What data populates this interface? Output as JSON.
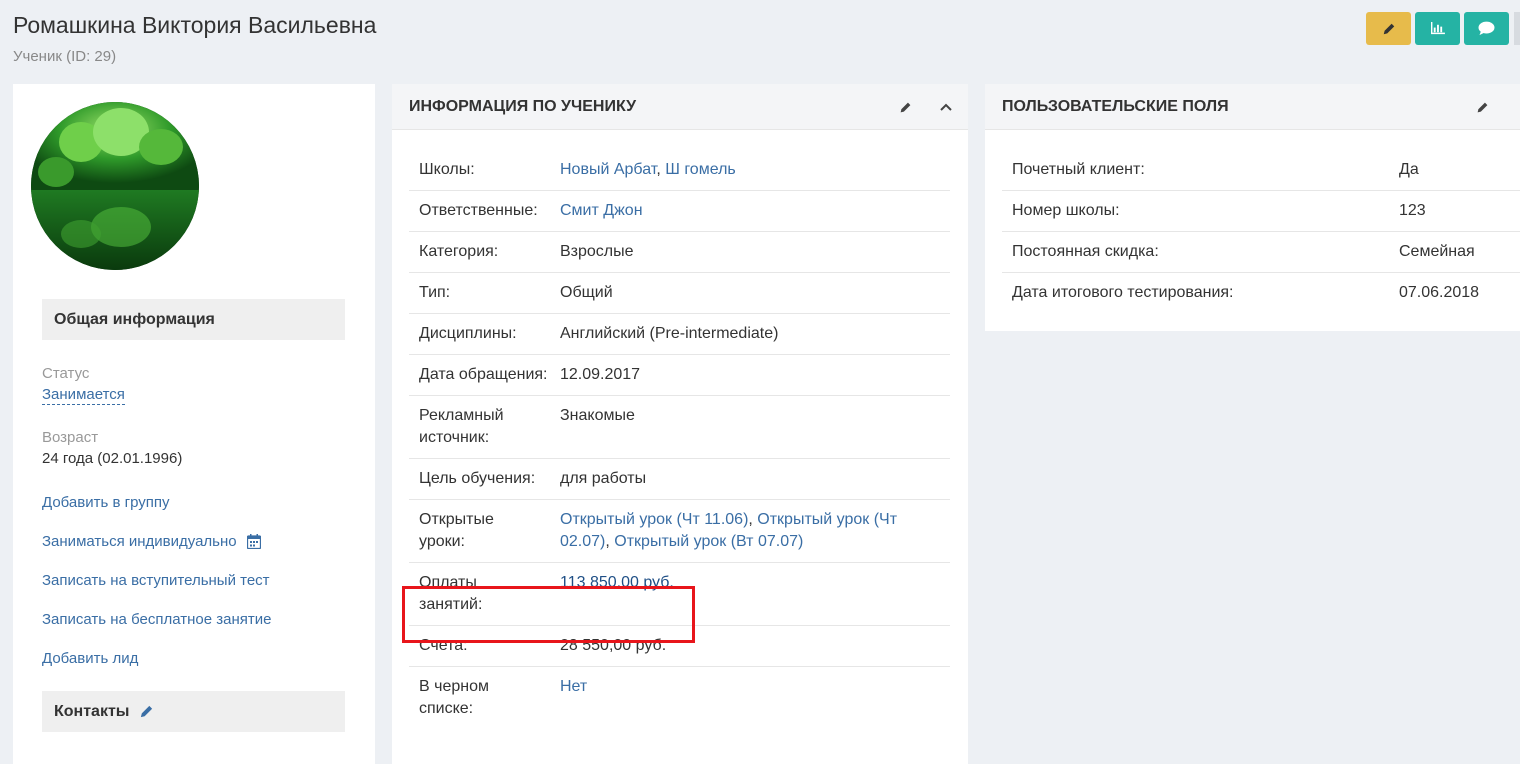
{
  "header": {
    "title": "Ромашкина Виктория Васильевна",
    "subtitle": "Ученик (ID: 29)"
  },
  "colors": {
    "accent": "#25b3a4",
    "edit": "#e7bb4b",
    "link": "#3a6ea5",
    "highlight": "#e8151b"
  },
  "left": {
    "general_title": "Общая информация",
    "status_label": "Статус",
    "status_value": "Занимается",
    "age_label": "Возраст",
    "age_value": "24 года (02.01.1996)",
    "actions": [
      "Добавить в группу",
      "Заниматься индивидуально",
      "Записать на вступительный тест",
      "Записать на бесплатное занятие",
      "Добавить лид"
    ],
    "contacts_title": "Контакты"
  },
  "info": {
    "title": "ИНФОРМАЦИЯ ПО УЧЕНИКУ",
    "rows": [
      {
        "label": "Школы:",
        "links": [
          "Новый Арбат",
          "Ш гомель"
        ]
      },
      {
        "label": "Ответственные:",
        "links": [
          "Смит Джон"
        ]
      },
      {
        "label": "Категория:",
        "value": "Взрослые"
      },
      {
        "label": "Тип:",
        "value": "Общий"
      },
      {
        "label": "Дисциплины:",
        "value": "Английский (Pre-intermediate)"
      },
      {
        "label": "Дата обращения:",
        "value": "12.09.2017"
      },
      {
        "label": "Рекламный источник:",
        "value": "Знакомые"
      },
      {
        "label": "Цель обучения:",
        "value": "для работы"
      },
      {
        "label": "Открытые уроки:",
        "links": [
          "Открытый урок (Чт 11.06)",
          "Открытый урок (Чт 02.07)",
          "Открытый урок (Вт 07.07)"
        ]
      },
      {
        "label": "Оплаты занятий:",
        "link_underlined": "113 850,00 руб."
      },
      {
        "label": "Счета:",
        "value": "28 550,00 руб."
      },
      {
        "label": "В черном списке:",
        "links": [
          "Нет"
        ]
      }
    ]
  },
  "custom": {
    "title": "ПОЛЬЗОВАТЕЛЬСКИЕ ПОЛЯ",
    "rows": [
      {
        "label": "Почетный клиент:",
        "value": "Да"
      },
      {
        "label": "Номер школы:",
        "value": "123"
      },
      {
        "label": "Постоянная скидка:",
        "value": "Семейная"
      },
      {
        "label": "Дата итогового тестирования:",
        "value": "07.06.2018"
      }
    ]
  }
}
